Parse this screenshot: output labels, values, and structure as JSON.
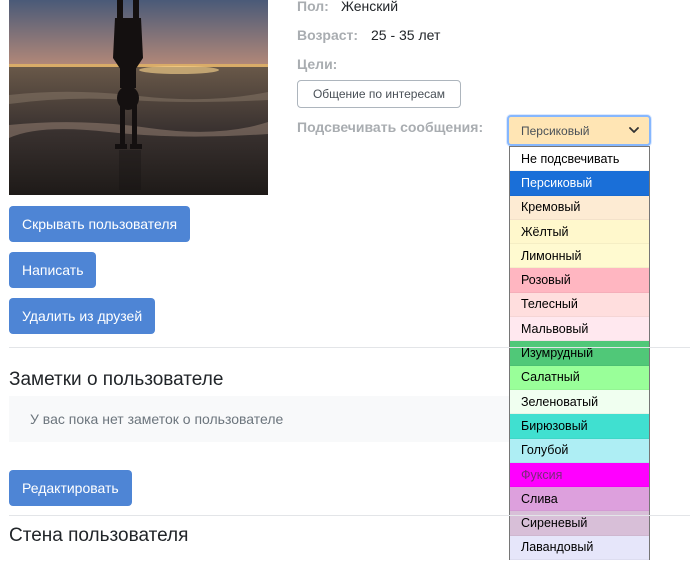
{
  "profile": {
    "gender_label": "Пол:",
    "gender_value": "Женский",
    "age_label": "Возраст:",
    "age_value": "25 - 35 лет",
    "goals_label": "Цели:",
    "goal_tag": "Общение по интересам",
    "highlight_label": "Подсвечивать сообщения:"
  },
  "highlight_select": {
    "selected": "Персиковый",
    "selected_color": "#ffe5b4",
    "options": [
      {
        "label": "Не подсвечивать",
        "color": "#ffffff",
        "text_color": "#000000"
      },
      {
        "label": "Персиковый",
        "color": "#1a6fd8",
        "text_color": "#ffffff"
      },
      {
        "label": "Кремовый",
        "color": "#fdebd3",
        "text_color": "#000000"
      },
      {
        "label": "Жёлтый",
        "color": "#fff8cc",
        "text_color": "#000000"
      },
      {
        "label": "Лимонный",
        "color": "#fffad0",
        "text_color": "#000000"
      },
      {
        "label": "Розовый",
        "color": "#ffb6c1",
        "text_color": "#000000"
      },
      {
        "label": "Телесный",
        "color": "#ffdede",
        "text_color": "#000000"
      },
      {
        "label": "Мальвовый",
        "color": "#ffe8ef",
        "text_color": "#000000"
      },
      {
        "label": "Изумрудный",
        "color": "#50c878",
        "text_color": "#000000"
      },
      {
        "label": "Салатный",
        "color": "#99ff99",
        "text_color": "#000000"
      },
      {
        "label": "Зеленоватый",
        "color": "#f0fff0",
        "text_color": "#000000"
      },
      {
        "label": "Бирюзовый",
        "color": "#40e0d0",
        "text_color": "#000000"
      },
      {
        "label": "Голубой",
        "color": "#aeeef4",
        "text_color": "#000000"
      },
      {
        "label": "Фуксия",
        "color": "#ff00ff",
        "text_color": "#7a2a7a"
      },
      {
        "label": "Слива",
        "color": "#dda0dd",
        "text_color": "#000000"
      },
      {
        "label": "Сиреневый",
        "color": "#d8bfd8",
        "text_color": "#000000"
      },
      {
        "label": "Лавандовый",
        "color": "#e6e6fa",
        "text_color": "#000000"
      }
    ]
  },
  "actions": {
    "hide_user": "Скрывать пользователя",
    "write": "Написать",
    "remove_friend": "Удалить из друзей",
    "edit": "Редактировать"
  },
  "notes": {
    "title": "Заметки о пользователе",
    "empty_text": "У вас пока нет заметок о пользователе"
  },
  "wall": {
    "title": "Стена пользователя"
  },
  "colors": {
    "primary_button": "#4e85d5",
    "label_gray": "#a9adb1"
  },
  "icons": {
    "select_chevron": "chevron-down-icon"
  }
}
